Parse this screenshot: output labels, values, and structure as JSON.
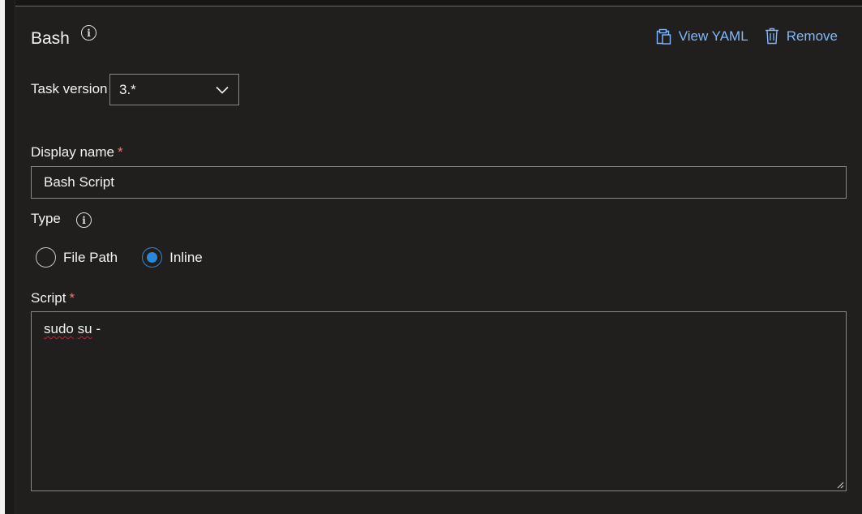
{
  "task": {
    "title": "Bash",
    "info_icon": "info-icon"
  },
  "actions": {
    "view_yaml": {
      "label": "View YAML",
      "icon": "clipboard-icon"
    },
    "remove": {
      "label": "Remove",
      "icon": "trash-icon"
    }
  },
  "task_version": {
    "label": "Task version",
    "value": "3.*",
    "icon": "chevron-down-icon"
  },
  "display_name": {
    "label": "Display name",
    "required_mark": "*",
    "value": "Bash Script"
  },
  "type": {
    "label": "Type",
    "info_icon": "info-icon",
    "options": [
      {
        "label": "File Path",
        "checked": false
      },
      {
        "label": "Inline",
        "checked": true
      }
    ]
  },
  "script": {
    "label": "Script",
    "required_mark": "*",
    "words": [
      "sudo",
      "su",
      "-"
    ]
  },
  "colors": {
    "background": "#201f1e",
    "link": "#7fb8ff",
    "accent": "#2b88d8",
    "required": "#e37d80",
    "border": "#8a8886"
  }
}
